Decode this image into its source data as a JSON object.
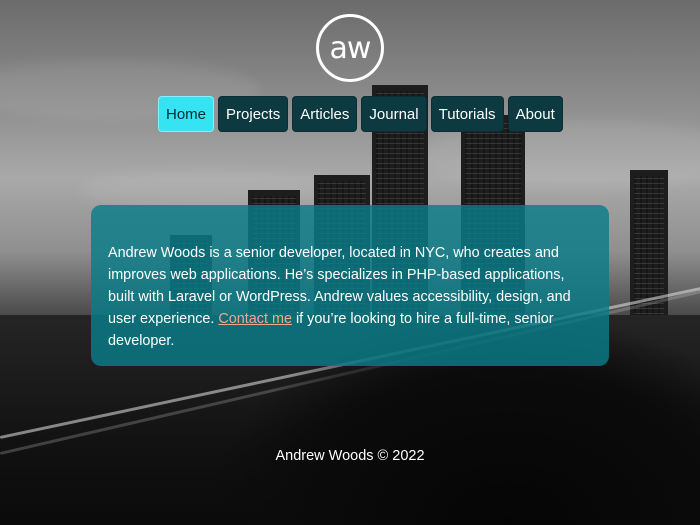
{
  "logo": {
    "text": "aw"
  },
  "nav": {
    "items": [
      {
        "label": "Home"
      },
      {
        "label": "Projects"
      },
      {
        "label": "Articles"
      },
      {
        "label": "Journal"
      },
      {
        "label": "Tutorials"
      },
      {
        "label": "About"
      }
    ],
    "active": "Home"
  },
  "intro": {
    "text_before": "Andrew Woods is a senior developer, located in NYC, who creates and improves web applications. He’s specializes in PHP-based applications, built with Laravel or WordPress. Andrew values accessibility, design, and user experience. ",
    "link_text": "Contact me",
    "text_after": " if you’re looking to hire a full-time, senior developer."
  },
  "footer": {
    "text": "Andrew Woods © 2022"
  },
  "colors": {
    "nav_active": "#35e3f2",
    "nav_bg": "#0c3a40",
    "card_bg": "#087d89",
    "link": "#f3a78f"
  }
}
